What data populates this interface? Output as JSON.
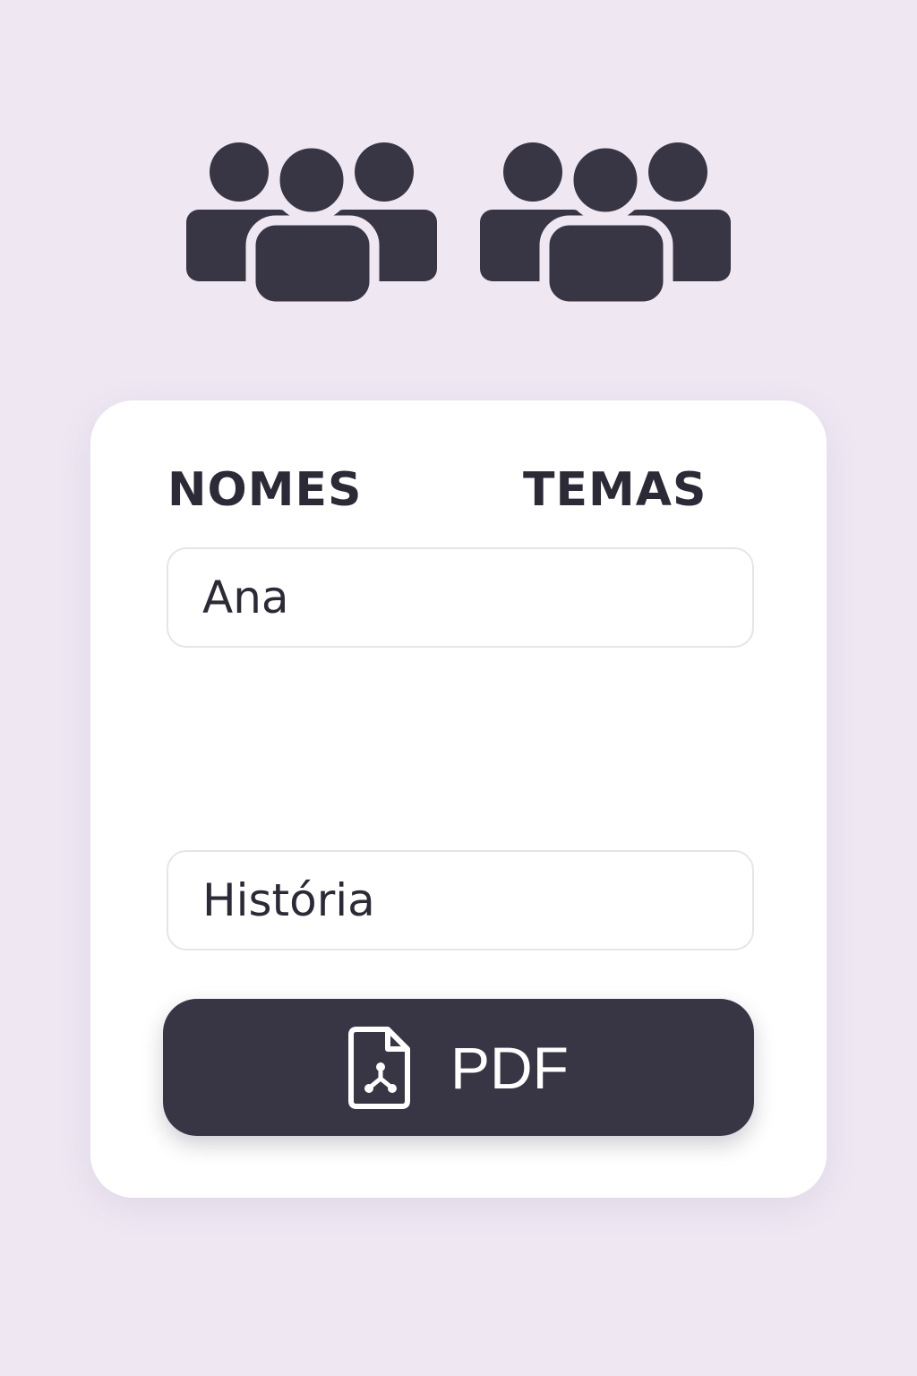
{
  "header": {
    "icons": [
      "group-icon",
      "group-icon"
    ]
  },
  "form": {
    "names_label": "NOMES",
    "themes_label": "TEMAS",
    "name_value": "Ana",
    "theme_value": "História"
  },
  "actions": {
    "pdf_label": "PDF",
    "pdf_icon": "pdf-file-icon"
  },
  "colors": {
    "background": "#efe8f3",
    "card": "#ffffff",
    "icon_dark": "#383544",
    "text": "#2b2a36",
    "button_text": "#ffffff"
  }
}
